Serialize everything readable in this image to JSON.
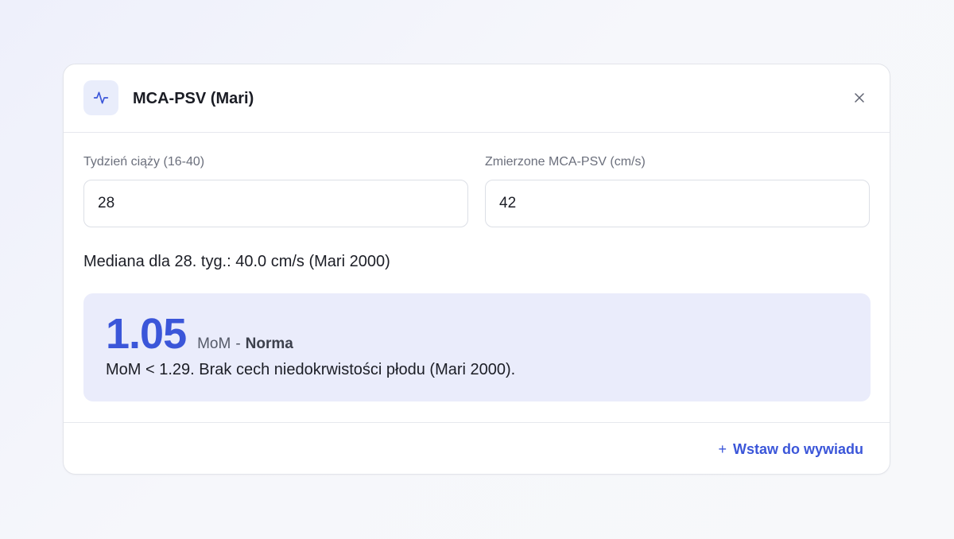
{
  "dialog": {
    "title": "MCA-PSV (Mari)",
    "icon": "activity-pulse-icon",
    "close_icon": "close-icon"
  },
  "fields": {
    "week": {
      "label": "Tydzień ciąży (16-40)",
      "value": "28"
    },
    "psv": {
      "label": "Zmierzone MCA-PSV (cm/s)",
      "value": "42"
    }
  },
  "median_text": "Mediana dla 28. tyg.: 40.0 cm/s (Mari 2000)",
  "result": {
    "mom_value": "1.05",
    "unit": "MoM",
    "separator": "-",
    "status": "Norma",
    "description": "MoM < 1.29. Brak cech niedokrwistości płodu (Mari 2000)."
  },
  "footer": {
    "insert_icon": "+",
    "insert_label": "Wstaw do wywiadu"
  },
  "colors": {
    "accent": "#3b56d9",
    "result_bg": "#eaecfb",
    "icon_bg": "#e9edfb"
  }
}
